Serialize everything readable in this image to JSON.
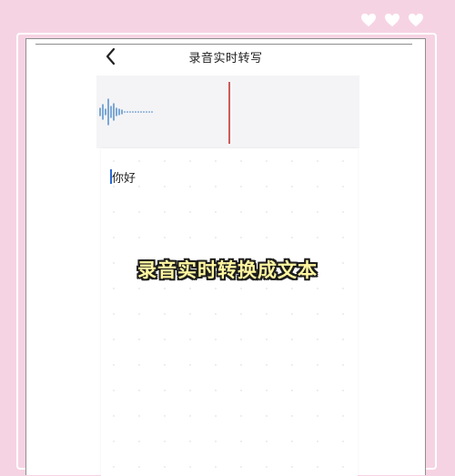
{
  "decoration": {
    "hearts_color": "#ffffff",
    "background_color": "#f6d3e3"
  },
  "header": {
    "title": "录音实时转写",
    "back_icon": "chevron-left-icon"
  },
  "recording": {
    "waveform_color": "#3b7fc4",
    "playhead_color": "#cf5a5a"
  },
  "transcript": {
    "text": "你好"
  },
  "overlay": {
    "caption": "录音实时转换成文本"
  }
}
